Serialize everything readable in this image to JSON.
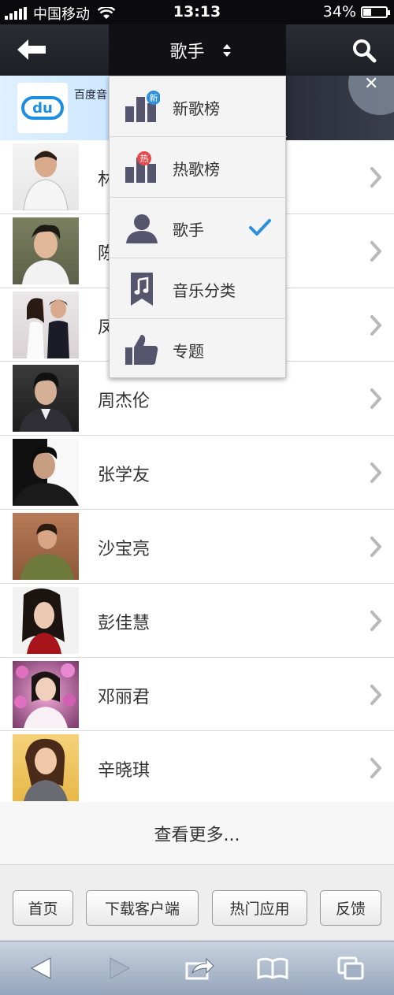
{
  "status_bar": {
    "carrier": "中国移动",
    "time": "13:13",
    "battery": "34%",
    "battery_level": 0.34
  },
  "nav": {
    "title": "歌手"
  },
  "banner": {
    "text": "百度音"
  },
  "dropdown": {
    "items": [
      {
        "label": "新歌榜",
        "icon": "chart-new-icon",
        "badge": "新"
      },
      {
        "label": "热歌榜",
        "icon": "chart-hot-icon",
        "badge": "热"
      },
      {
        "label": "歌手",
        "icon": "person-icon",
        "selected": true
      },
      {
        "label": "音乐分类",
        "icon": "music-note-icon"
      },
      {
        "label": "专题",
        "icon": "thumbs-up-icon"
      }
    ]
  },
  "singers": [
    {
      "name": "林"
    },
    {
      "name": "陈"
    },
    {
      "name": "凤"
    },
    {
      "name": "周杰伦"
    },
    {
      "name": "张学友"
    },
    {
      "name": "沙宝亮"
    },
    {
      "name": "彭佳慧"
    },
    {
      "name": "邓丽君"
    },
    {
      "name": "辛晓琪"
    }
  ],
  "more_label": "查看更多...",
  "footer_links": [
    "首页",
    "下载客户端",
    "热门应用",
    "反馈"
  ],
  "colors": {
    "accent": "#2b8fe0",
    "icon": "#55566e",
    "hot_badge": "#e64a4a"
  }
}
